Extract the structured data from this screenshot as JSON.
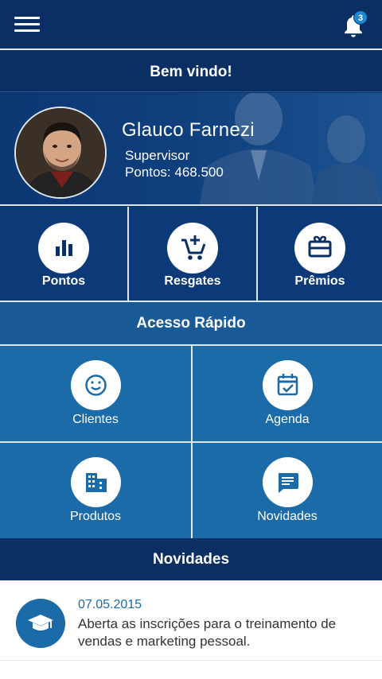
{
  "header": {
    "menu_icon": "hamburger-icon",
    "bell_icon": "bell-icon",
    "notification_count": "3"
  },
  "welcome": {
    "title": "Bem vindo!"
  },
  "profile": {
    "name": "Glauco Farnezi",
    "role": "Supervisor",
    "points": "Pontos: 468.500"
  },
  "main_tiles": [
    {
      "label": "Pontos",
      "icon": "bar-chart-icon"
    },
    {
      "label": "Resgates",
      "icon": "cart-add-icon"
    },
    {
      "label": "Prêmios",
      "icon": "gift-card-icon"
    }
  ],
  "quick_access": {
    "title": "Acesso Rápido",
    "tiles": [
      {
        "label": "Clientes",
        "icon": "smiley-icon"
      },
      {
        "label": "Agenda",
        "icon": "calendar-check-icon"
      },
      {
        "label": "Produtos",
        "icon": "building-icon"
      },
      {
        "label": "Novidades",
        "icon": "message-icon"
      }
    ]
  },
  "news": {
    "title": "Novidades",
    "items": [
      {
        "date": "07.05.2015",
        "text": "Aberta as inscrições para o treinamento de vendas e marketing pessoal.",
        "icon": "graduation-cap-icon"
      }
    ]
  },
  "colors": {
    "navy": "#0b2f63",
    "tile_blue": "#1b6ba8",
    "accent": "#1e8ad6"
  }
}
